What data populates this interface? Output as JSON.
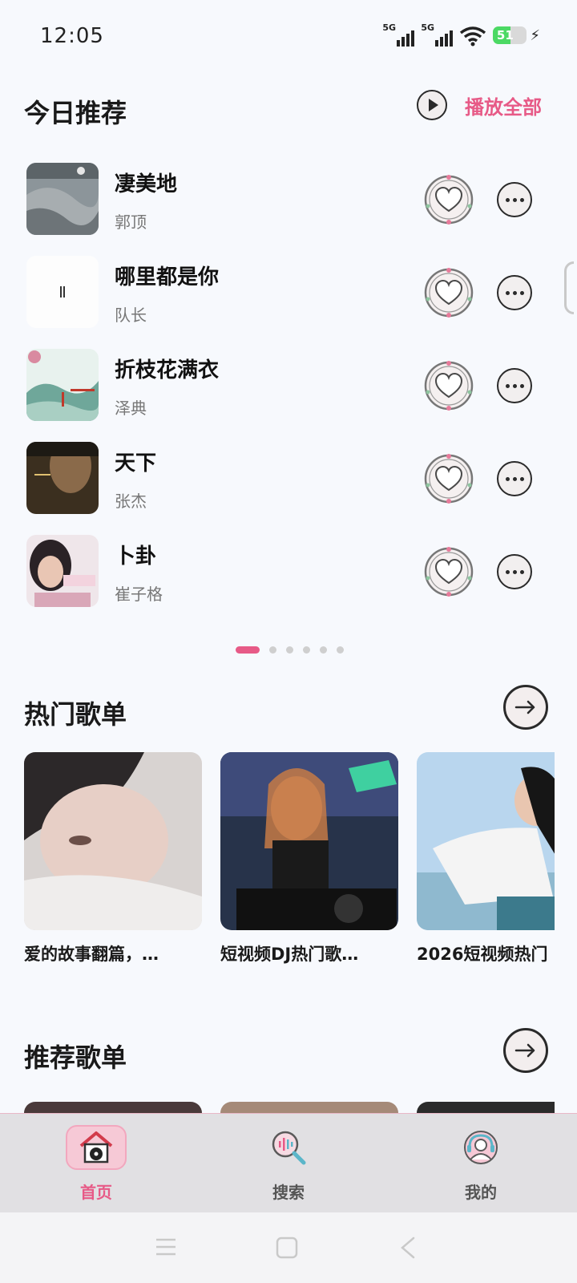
{
  "status_bar": {
    "time": "12:05",
    "signal1_label": "5G",
    "signal2_label": "5G",
    "battery_level": "51",
    "battery_percent": 51
  },
  "today": {
    "title": "今日推荐",
    "play_all_label": "播放全部",
    "songs": [
      {
        "name": "凄美地",
        "artist": "郭顶"
      },
      {
        "name": "哪里都是你",
        "artist": "队长"
      },
      {
        "name": "折枝花满衣",
        "artist": "泽典"
      },
      {
        "name": "天下",
        "artist": "张杰"
      },
      {
        "name": "卜卦",
        "artist": "崔子格"
      }
    ],
    "pager": {
      "count": 6,
      "active": 0
    }
  },
  "hot_playlists": {
    "title": "热门歌单",
    "items": [
      {
        "title": "爱的故事翻篇，…"
      },
      {
        "title": "短视频DJ热门歌…"
      },
      {
        "title": "2026短视频热门"
      }
    ]
  },
  "recommended_playlists": {
    "title": "推荐歌单"
  },
  "bottom_nav": {
    "items": [
      {
        "label": "首页",
        "icon": "home-icon",
        "active": true
      },
      {
        "label": "搜索",
        "icon": "search-icon",
        "active": false
      },
      {
        "label": "我的",
        "icon": "profile-icon",
        "active": false
      }
    ]
  },
  "colors": {
    "accent": "#e75a87",
    "background": "#f7f9fd",
    "nav_background": "#e1e0e3"
  }
}
